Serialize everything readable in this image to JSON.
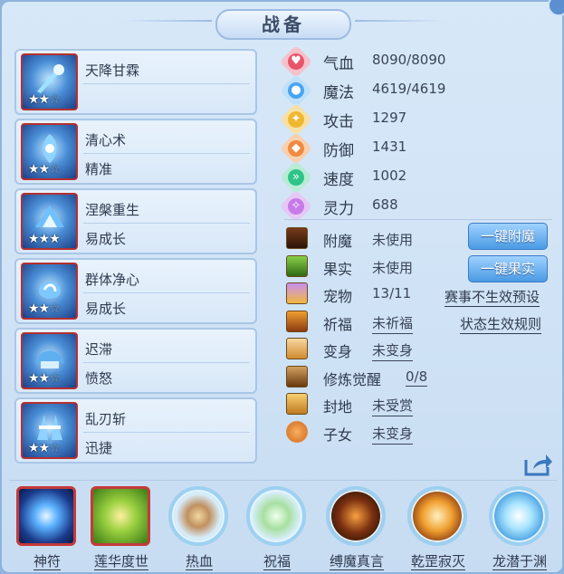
{
  "title": "战备",
  "skills": [
    {
      "name": "天降甘霖",
      "sub": "",
      "stars": 2,
      "max_stars": 3
    },
    {
      "name": "清心术",
      "sub": "精准",
      "stars": 2,
      "max_stars": 3
    },
    {
      "name": "涅槃重生",
      "sub": "易成长",
      "stars": 3,
      "max_stars": 3
    },
    {
      "name": "群体净心",
      "sub": "易成长",
      "stars": 2,
      "max_stars": 3
    },
    {
      "name": "迟滞",
      "sub": "愤怒",
      "stars": 2,
      "max_stars": 3
    },
    {
      "name": "乱刃斩",
      "sub": "迅捷",
      "stars": 2,
      "max_stars": 3
    }
  ],
  "stats": [
    {
      "label": "气血",
      "value": "8090/8090",
      "icon": "heart-icon",
      "color": "#e8556a"
    },
    {
      "label": "魔法",
      "value": "4619/4619",
      "icon": "mana-icon",
      "color": "#4aa4f0"
    },
    {
      "label": "攻击",
      "value": "1297",
      "icon": "sword-icon",
      "color": "#f0b830"
    },
    {
      "label": "防御",
      "value": "1431",
      "icon": "shield-icon",
      "color": "#f08a40"
    },
    {
      "label": "速度",
      "value": "1002",
      "icon": "speed-icon",
      "color": "#2ec48a"
    },
    {
      "label": "灵力",
      "value": "688",
      "icon": "spirit-icon",
      "color": "#c77ae8"
    }
  ],
  "attrs": [
    {
      "label": "附魔",
      "value": "未使用",
      "underline": false,
      "icon": "enchant-icon"
    },
    {
      "label": "果实",
      "value": "未使用",
      "underline": false,
      "icon": "fruit-icon"
    },
    {
      "label": "宠物",
      "value": "13/11",
      "underline": false,
      "icon": "pet-icon"
    },
    {
      "label": "祈福",
      "value": "未祈福",
      "underline": true,
      "icon": "pray-icon"
    },
    {
      "label": "变身",
      "value": "未变身",
      "underline": true,
      "icon": "transform-icon"
    },
    {
      "label": "修炼觉醒",
      "value": "0/8",
      "underline": true,
      "icon": "cultivate-icon"
    },
    {
      "label": "封地",
      "value": "未受赏",
      "underline": true,
      "icon": "fief-icon"
    },
    {
      "label": "子女",
      "value": "未变身",
      "underline": true,
      "icon": "child-icon"
    }
  ],
  "buttons": {
    "enchant": "一键附魔",
    "fruit": "一键果实"
  },
  "links": {
    "event_preset": "赛事不生效预设",
    "status_rules": "状态生效规则"
  },
  "bottom": [
    {
      "label": "神符",
      "shape": "square"
    },
    {
      "label": "莲华度世",
      "shape": "square"
    },
    {
      "label": "热血",
      "shape": "round"
    },
    {
      "label": "祝福",
      "shape": "round"
    },
    {
      "label": "缚魔真言",
      "shape": "round"
    },
    {
      "label": "乾罡寂灭",
      "shape": "round"
    },
    {
      "label": "龙潜于渊",
      "shape": "round"
    }
  ]
}
